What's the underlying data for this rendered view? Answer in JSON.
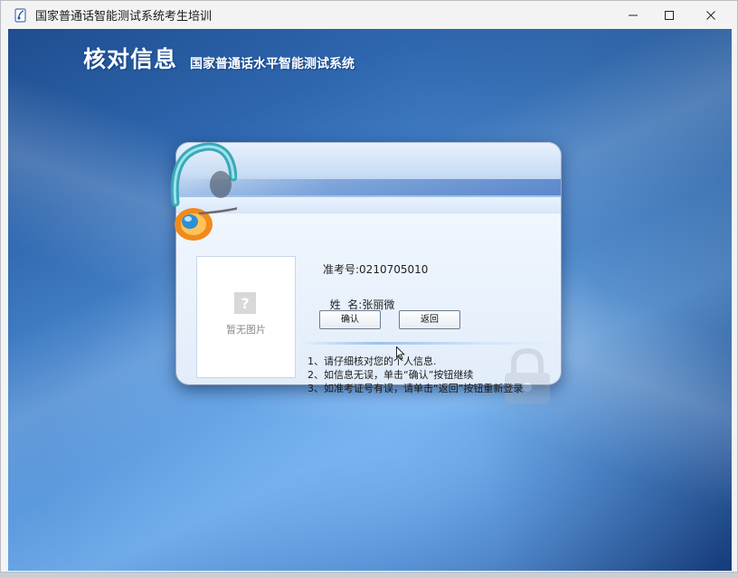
{
  "window": {
    "title": "国家普通话智能测试系统考生培训",
    "controls": [
      "minimize",
      "maximize",
      "close"
    ]
  },
  "dialog": {
    "title": "核对信息",
    "subtitle": "国家普通话水平智能测试系统",
    "photo": {
      "placeholder_text": "暂无图片",
      "icon": "image-placeholder-icon"
    },
    "fields": {
      "ticket": {
        "label": "准考号:",
        "value": "0210705010"
      },
      "name": {
        "label": "姓  名:",
        "value": "张丽微"
      }
    },
    "buttons": {
      "confirm": "确认",
      "back": "返回"
    },
    "instructions": [
      "1、请仔细核对您的个人信息.",
      "2、如信息无误，单击“确认”按钮继续",
      "3、如准考证号有误，请单击“返回”按钮重新登录"
    ]
  },
  "colors": {
    "background_dark": "#1f4d8f",
    "background_light": "#6eaae8",
    "header_blue": "#3c6ebe",
    "headset_teal": "#3aa8b8",
    "headset_orange": "#f08a1c"
  }
}
